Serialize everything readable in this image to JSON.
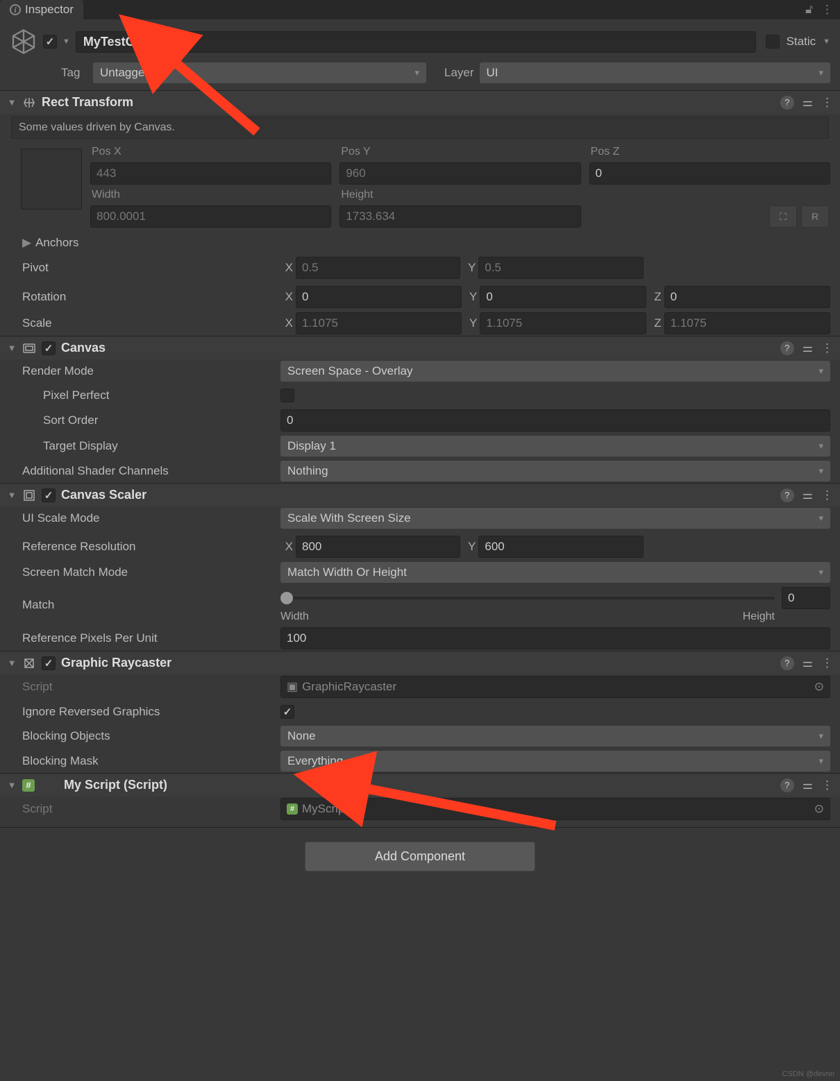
{
  "tab": {
    "title": "Inspector"
  },
  "header": {
    "name": "MyTestObject",
    "enabled": true,
    "static_label": "Static",
    "tag_label": "Tag",
    "tag_value": "Untagged",
    "layer_label": "Layer",
    "layer_value": "UI"
  },
  "rect_transform": {
    "title": "Rect Transform",
    "info": "Some values driven by Canvas.",
    "posx_label": "Pos X",
    "posx": "443",
    "posy_label": "Pos Y",
    "posy": "960",
    "posz_label": "Pos Z",
    "posz": "0",
    "width_label": "Width",
    "width": "800.0001",
    "height_label": "Height",
    "height": "1733.634",
    "anchors_label": "Anchors",
    "pivot_label": "Pivot",
    "pivot_x": "0.5",
    "pivot_y": "0.5",
    "rotation_label": "Rotation",
    "rot_x": "0",
    "rot_y": "0",
    "rot_z": "0",
    "scale_label": "Scale",
    "scale_x": "1.1075",
    "scale_y": "1.1075",
    "scale_z": "1.1075",
    "blueprint_btn": "⛶",
    "reset_btn": "R"
  },
  "canvas": {
    "title": "Canvas",
    "render_mode_label": "Render Mode",
    "render_mode": "Screen Space - Overlay",
    "pixel_perfect_label": "Pixel Perfect",
    "sort_order_label": "Sort Order",
    "sort_order": "0",
    "target_display_label": "Target Display",
    "target_display": "Display 1",
    "addl_channels_label": "Additional Shader Channels",
    "addl_channels": "Nothing"
  },
  "canvas_scaler": {
    "title": "Canvas Scaler",
    "scale_mode_label": "UI Scale Mode",
    "scale_mode": "Scale With Screen Size",
    "ref_res_label": "Reference Resolution",
    "ref_x": "800",
    "ref_y": "600",
    "match_mode_label": "Screen Match Mode",
    "match_mode": "Match Width Or Height",
    "match_label": "Match",
    "match_value": "0",
    "match_min": "Width",
    "match_max": "Height",
    "ref_ppu_label": "Reference Pixels Per Unit",
    "ref_ppu": "100"
  },
  "graphic_raycaster": {
    "title": "Graphic Raycaster",
    "script_label": "Script",
    "script_value": "GraphicRaycaster",
    "ignore_rev_label": "Ignore Reversed Graphics",
    "blocking_obj_label": "Blocking Objects",
    "blocking_obj": "None",
    "blocking_mask_label": "Blocking Mask",
    "blocking_mask": "Everything"
  },
  "my_script": {
    "title": "My Script (Script)",
    "script_label": "Script",
    "script_value": "MyScript"
  },
  "add_component": "Add Component",
  "watermark": "CSDN @devnn",
  "axis": {
    "x": "X",
    "y": "Y",
    "z": "Z"
  }
}
